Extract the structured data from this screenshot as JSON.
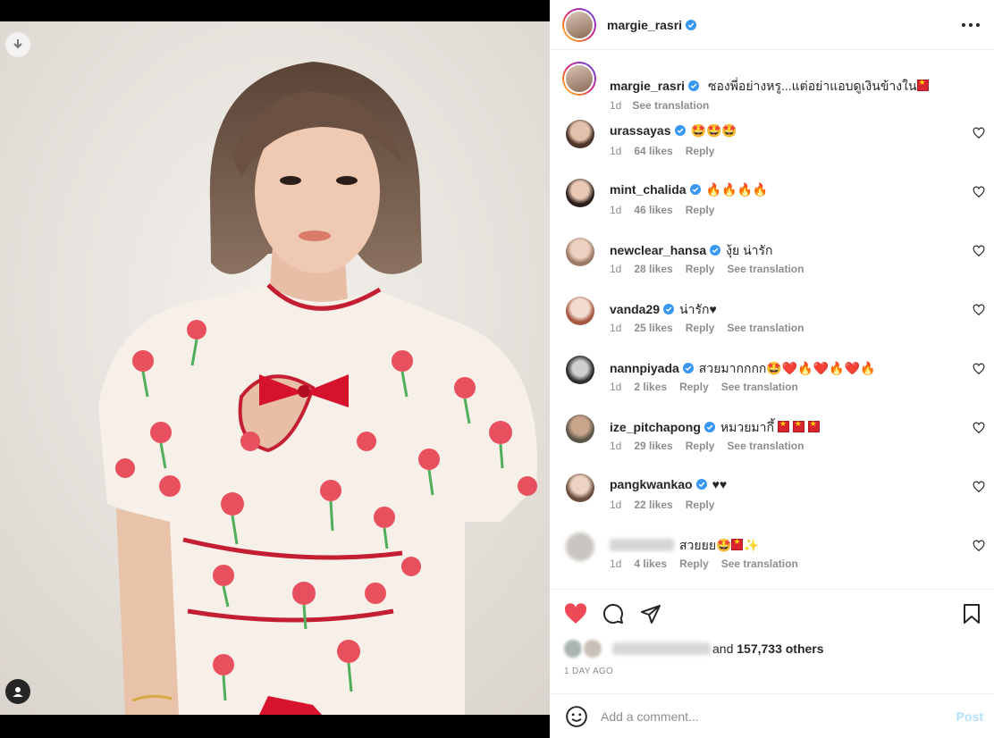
{
  "post": {
    "author": "margie_rasri",
    "caption": "ซองพี่อย่างหรู...แต่อย่าแอบดูเงินข้างใน",
    "caption_time": "1d",
    "see_translation": "See translation",
    "reply_label": "Reply"
  },
  "comments": [
    {
      "user": "urassayas",
      "verified": true,
      "text": "🤩🤩🤩",
      "time": "1d",
      "likes": "64 likes",
      "translate": false
    },
    {
      "user": "mint_chalida",
      "verified": true,
      "text": "🔥🔥🔥🔥",
      "time": "1d",
      "likes": "46 likes",
      "translate": false
    },
    {
      "user": "newclear_hansa",
      "verified": true,
      "text": "งุ้ย น่ารัก",
      "time": "1d",
      "likes": "28 likes",
      "translate": true
    },
    {
      "user": "vanda29",
      "verified": true,
      "text": "น่ารัก♥",
      "time": "1d",
      "likes": "25 likes",
      "translate": true
    },
    {
      "user": "nannpiyada",
      "verified": true,
      "text": "สวยมากกกก🤩❤️🔥❤️🔥❤️🔥",
      "time": "1d",
      "likes": "2 likes",
      "translate": true
    },
    {
      "user": "ize_pitchapong",
      "verified": true,
      "text": "หมวยมากึ้",
      "time": "1d",
      "likes": "29 likes",
      "translate": true
    },
    {
      "user": "pangkwankao",
      "verified": true,
      "text": "♥♥",
      "time": "1d",
      "likes": "22 likes",
      "translate": false
    },
    {
      "user": "",
      "verified": false,
      "text": "สวยยย🤩",
      "time": "1d",
      "likes": "4 likes",
      "translate": true
    }
  ],
  "likes": {
    "suffix": "and",
    "count": "157,733 others"
  },
  "timestamp": "1 DAY AGO",
  "comment_box": {
    "placeholder": "Add a comment...",
    "post_label": "Post"
  },
  "colors": {
    "like_red": "#ed4956",
    "verified_blue": "#3897f0",
    "post_blue": "#b2dffc"
  }
}
